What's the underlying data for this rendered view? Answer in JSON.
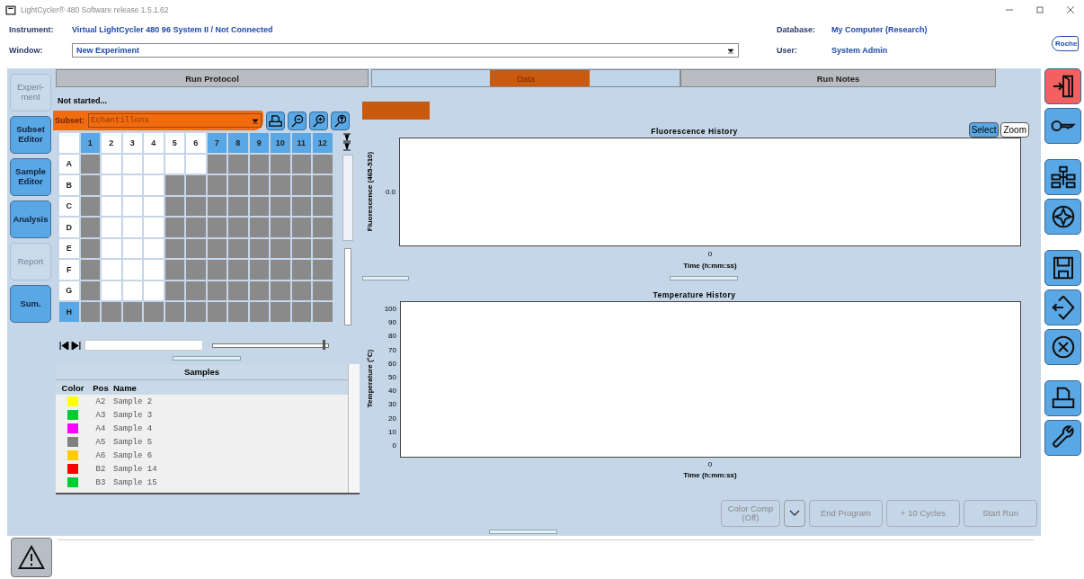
{
  "title_bar": {
    "title": "LightCycler® 480 Software release 1.5.1.62"
  },
  "header": {
    "instrument_label": "Instrument:",
    "instrument": "Virtual LightCycler 480 96 System II / Not Connected",
    "database_label": "Database:",
    "database": "My Computer (Research)",
    "window_label": "Window:",
    "window": "New Experiment",
    "user_label": "User:",
    "user": "System Admin",
    "logo": "Roche"
  },
  "nav": [
    {
      "label": "Experi-ment",
      "disabled": true
    },
    {
      "label": "Subset Editor",
      "disabled": false
    },
    {
      "label": "Sample Editor",
      "disabled": false
    },
    {
      "label": "Analysis",
      "disabled": false
    },
    {
      "label": "Report",
      "disabled": true
    },
    {
      "label": "Sum.",
      "disabled": false
    }
  ],
  "tabs": [
    {
      "label": "Run Protocol",
      "selected": false
    },
    {
      "label": "Data",
      "selected": true
    },
    {
      "label": "Run Notes",
      "selected": false
    }
  ],
  "status": "Not started...",
  "subset": {
    "label": "Subset:",
    "value": "Echantillons"
  },
  "plate": {
    "columns": [
      {
        "label": "1",
        "selected": true
      },
      {
        "label": "2",
        "selected": false
      },
      {
        "label": "3",
        "selected": false
      },
      {
        "label": "4",
        "selected": false
      },
      {
        "label": "5",
        "selected": false
      },
      {
        "label": "6",
        "selected": false
      },
      {
        "label": "7",
        "selected": true
      },
      {
        "label": "8",
        "selected": true
      },
      {
        "label": "9",
        "selected": true
      },
      {
        "label": "10",
        "selected": true
      },
      {
        "label": "11",
        "selected": true
      },
      {
        "label": "12",
        "selected": true
      }
    ],
    "rows": [
      {
        "label": "A",
        "selected": false,
        "wells": [
          false,
          true,
          true,
          true,
          true,
          true,
          false,
          false,
          false,
          false,
          false,
          false
        ]
      },
      {
        "label": "B",
        "selected": false,
        "wells": [
          false,
          true,
          true,
          true,
          false,
          false,
          false,
          false,
          false,
          false,
          false,
          false
        ]
      },
      {
        "label": "C",
        "selected": false,
        "wells": [
          false,
          true,
          true,
          true,
          false,
          false,
          false,
          false,
          false,
          false,
          false,
          false
        ]
      },
      {
        "label": "D",
        "selected": false,
        "wells": [
          false,
          true,
          true,
          true,
          false,
          false,
          false,
          false,
          false,
          false,
          false,
          false
        ]
      },
      {
        "label": "E",
        "selected": false,
        "wells": [
          false,
          true,
          true,
          true,
          false,
          false,
          false,
          false,
          false,
          false,
          false,
          false
        ]
      },
      {
        "label": "F",
        "selected": false,
        "wells": [
          false,
          true,
          true,
          true,
          false,
          false,
          false,
          false,
          false,
          false,
          false,
          false
        ]
      },
      {
        "label": "G",
        "selected": false,
        "wells": [
          false,
          true,
          true,
          true,
          false,
          false,
          false,
          false,
          false,
          false,
          false,
          false
        ]
      },
      {
        "label": "H",
        "selected": true,
        "wells": [
          false,
          false,
          false,
          false,
          false,
          false,
          false,
          false,
          false,
          false,
          false,
          false
        ]
      }
    ]
  },
  "plate_slider": {
    "level": 0.95
  },
  "samples": {
    "title": "Samples",
    "columns": [
      "Color",
      "Pos",
      "Name"
    ],
    "rows": [
      {
        "color": "#ffff00",
        "pos": "A2",
        "name": "Sample 2"
      },
      {
        "color": "#00cc33",
        "pos": "A3",
        "name": "Sample 3"
      },
      {
        "color": "#ff00ff",
        "pos": "A4",
        "name": "Sample 4"
      },
      {
        "color": "#808080",
        "pos": "A5",
        "name": "Sample 5"
      },
      {
        "color": "#ffcc00",
        "pos": "A6",
        "name": "Sample 6"
      },
      {
        "color": "#ff0000",
        "pos": "B2",
        "name": "Sample 14"
      },
      {
        "color": "#00cc33",
        "pos": "B3",
        "name": "Sample 15"
      }
    ]
  },
  "fluorescence": {
    "modes": [
      {
        "label": "Select",
        "selected": true
      },
      {
        "label": "Zoom",
        "selected": false
      }
    ],
    "title": "Fluorescence History",
    "xlabel": "Time (h:mm:ss)",
    "ylabel": "Fluorescence (465-510)",
    "x_tick_labels": [
      "0"
    ],
    "y_tick_labels": [
      "0.0"
    ]
  },
  "temperature": {
    "title": "Temperature History",
    "xlabel": "Time (h:mm:ss)",
    "ylabel": "Temperature (°C)",
    "x_tick_labels": [
      "0"
    ],
    "y_tick_labels": [
      "100",
      "90",
      "80",
      "70",
      "60",
      "50",
      "40",
      "30",
      "20",
      "10",
      "0"
    ]
  },
  "run_buttons": [
    {
      "label": "Color Comp\n(Off)",
      "disabled": true
    },
    {
      "label": "End Program",
      "disabled": true
    },
    {
      "label": "+ 10 Cycles",
      "disabled": true
    },
    {
      "label": "Start Run",
      "disabled": true
    }
  ],
  "toolbar": [
    [
      {
        "kind": "exit"
      },
      {
        "kind": "key"
      }
    ],
    [
      {
        "kind": "network"
      },
      {
        "kind": "compass"
      }
    ],
    [
      {
        "kind": "save"
      },
      {
        "kind": "export"
      },
      {
        "kind": "cancel"
      }
    ],
    [
      {
        "kind": "print"
      },
      {
        "kind": "wrench"
      }
    ]
  ]
}
